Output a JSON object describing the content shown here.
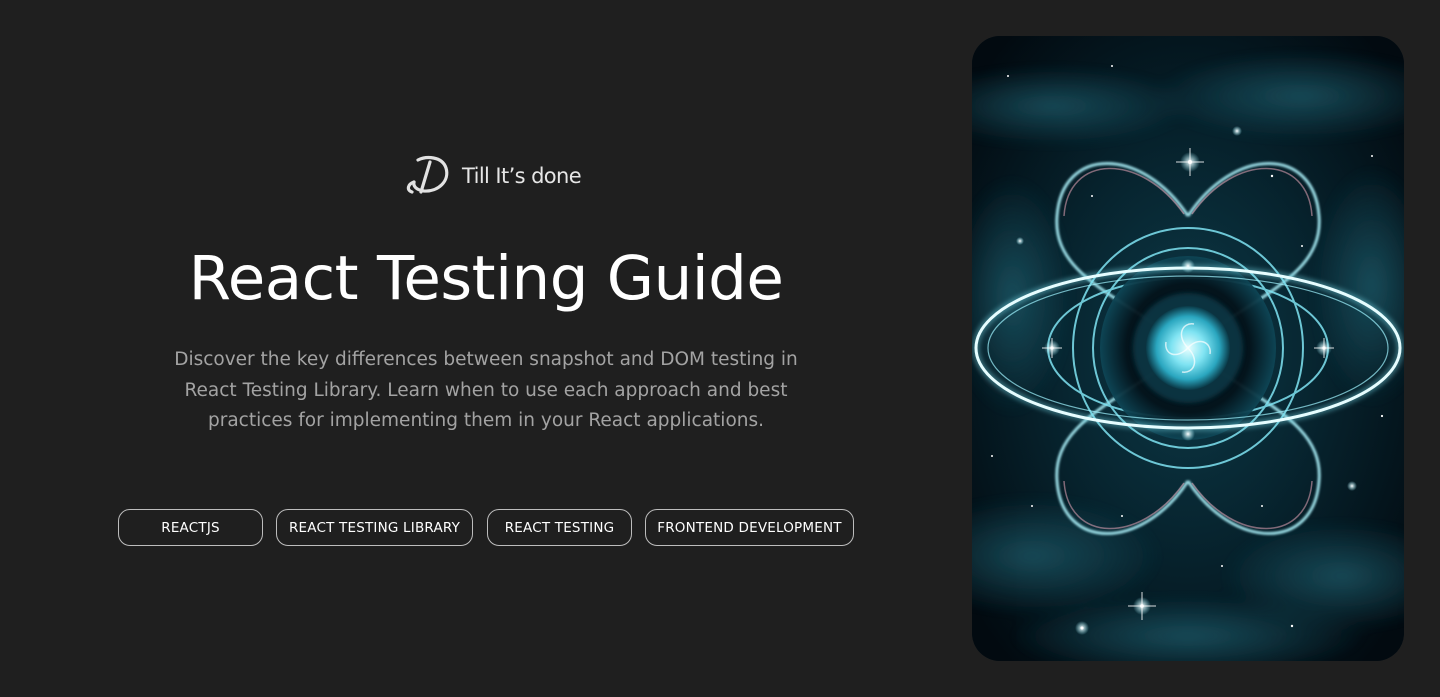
{
  "brand": {
    "name": "Till It’s done",
    "logo_icon": "till-its-done-logo-icon"
  },
  "hero": {
    "title": "React Testing Guide",
    "description": "Discover the key differences between snapshot and DOM testing in React Testing Library. Learn when to use each approach and best practices for implementing them in your React applications.",
    "image_icon": "cosmic-atom-illustration"
  },
  "tags": [
    {
      "label": "REACTJS"
    },
    {
      "label": "REACT TESTING LIBRARY"
    },
    {
      "label": "REACT TESTING"
    },
    {
      "label": "FRONTEND DEVELOPMENT"
    }
  ],
  "colors": {
    "background": "#1f1f1f",
    "title": "#ffffff",
    "description": "#a3a3a3",
    "tag_border": "#bdbdbd",
    "image_glow": "#7fe3f2"
  }
}
